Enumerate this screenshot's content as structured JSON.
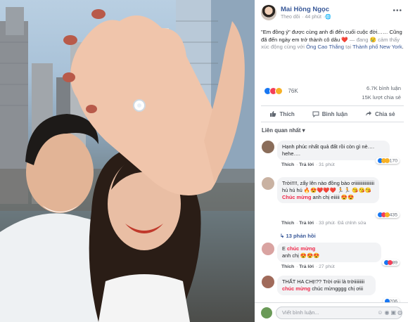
{
  "post": {
    "author": "Mai Hồng Ngọc",
    "follow": "Theo dõi",
    "time": "44 phút",
    "text_line": "\"Em đồng ý\" được cùng anh đi đến cuối cuộc đời…… Cũng đã đến ngày em trở thành cô dâu ",
    "feeling_prefix": " — đang ",
    "feeling": "cảm thấy xúc động cùng với ",
    "tagged": "Ông Cao Thắng",
    "at": " tại ",
    "place": "Thành phố New York",
    "end": "."
  },
  "reactions": {
    "count": "76K",
    "comments": "6.7K bình luận",
    "shares": "15K lượt chia sẻ"
  },
  "actions": {
    "like": "Thích",
    "comment": "Bình luận",
    "share": "Chia sẻ"
  },
  "filter_label": "Liên quan nhất ▾",
  "comments": [
    {
      "text": "Hạnh phúc nhất quả đất rồi còn gì nè…. hehe….",
      "like": "Thích",
      "reply": "Trả lời",
      "time": "31 phút",
      "count": "170"
    },
    {
      "text1": "Trời!!!!, zẩy lên nào đồng bào ơiiiiiiiiiiiiiiiii hú hú hú ",
      "text2": "Chúc mừng",
      "text3": " anh chị eiiiii ",
      "like": "Thích",
      "reply": "Trả lời",
      "time": "33 phút",
      "edited": "Đã chỉnh sửa",
      "count": "435"
    },
    {
      "text1": "E ",
      "text2": "chúc mừng",
      "text3": " anh chị ",
      "like": "Thích",
      "reply": "Trả lời",
      "time": "27 phút",
      "count": "89"
    },
    {
      "text1": "THẤT HA CHỊ!?? Trời ơiii là trờiiiiiiiii ",
      "text2": "chúc mừng",
      "text3": " chúc mừngggg chị ơiii",
      "count": "206"
    }
  ],
  "replies_label": "13 phản hồi",
  "composer": {
    "placeholder": "Viết bình luận..."
  },
  "colors": {
    "fb_link": "#385898",
    "love": "#f33e58",
    "like": "#1877f2"
  }
}
